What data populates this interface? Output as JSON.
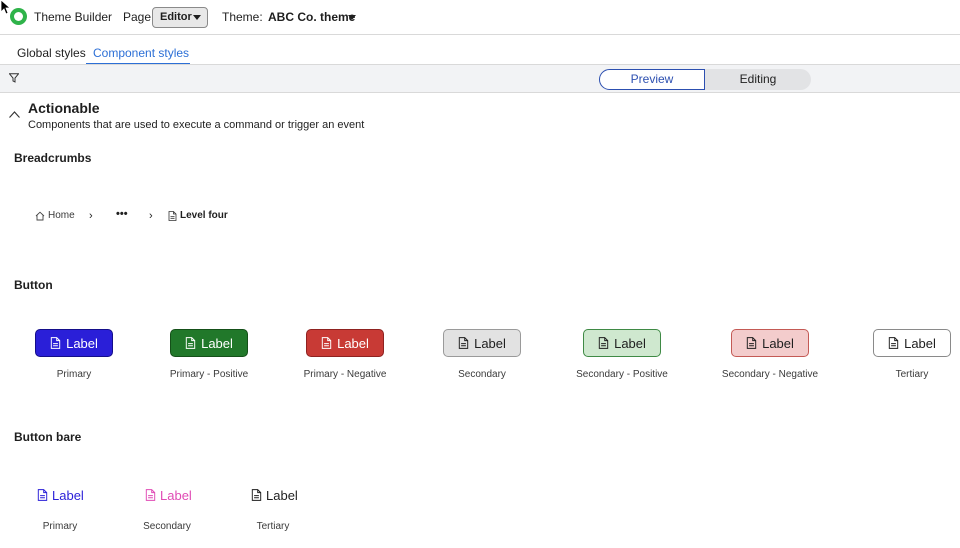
{
  "header": {
    "app_title": "Theme Builder",
    "page_label": "Page:",
    "page_value": "Editor",
    "theme_label": "Theme:",
    "theme_value": "ABC Co. theme"
  },
  "tabs": [
    {
      "label": "Global styles",
      "active": false
    },
    {
      "label": "Component styles",
      "active": true
    }
  ],
  "toolbar": {
    "filter_icon": "filter-icon",
    "segments": [
      {
        "label": "Preview",
        "selected": true
      },
      {
        "label": "Editing",
        "selected": false
      }
    ]
  },
  "section": {
    "title": "Actionable",
    "description": "Components that are used to execute a command or trigger an event",
    "collapse_icon": "chevron-up-icon"
  },
  "breadcrumbs": {
    "title": "Breadcrumbs",
    "items": [
      {
        "label": "Home",
        "icon": "home-icon"
      },
      {
        "label": "•••",
        "icon": null
      },
      {
        "label": "Level four",
        "icon": "document-icon"
      }
    ],
    "separator": "›"
  },
  "button": {
    "title": "Button",
    "variants": [
      {
        "label": "Label",
        "caption": "Primary",
        "bg": "#2a1fd8",
        "color": "#ffffff"
      },
      {
        "label": "Label",
        "caption": "Primary - Positive",
        "bg": "#21782a",
        "color": "#ffffff"
      },
      {
        "label": "Label",
        "caption": "Primary - Negative",
        "bg": "#c83a35",
        "color": "#ffffff"
      },
      {
        "label": "Label",
        "caption": "Secondary",
        "bg": "#e2e2e2",
        "color": "#1f1f1f"
      },
      {
        "label": "Label",
        "caption": "Secondary - Positive",
        "bg": "#cfe8cf",
        "color": "#1f1f1f"
      },
      {
        "label": "Label",
        "caption": "Secondary - Negative",
        "bg": "#f3cccc",
        "color": "#1f1f1f"
      },
      {
        "label": "Label",
        "caption": "Tertiary",
        "bg": "#ffffff",
        "color": "#1f1f1f"
      }
    ]
  },
  "button_bare": {
    "title": "Button bare",
    "variants": [
      {
        "label": "Label",
        "caption": "Primary",
        "color": "#2a1fd8"
      },
      {
        "label": "Label",
        "caption": "Secondary",
        "color": "#e04bb5"
      },
      {
        "label": "Label",
        "caption": "Tertiary",
        "color": "#1f1f1f"
      }
    ]
  },
  "colors": {
    "accent": "#2c6fd6",
    "logo": "#2fb34a"
  }
}
